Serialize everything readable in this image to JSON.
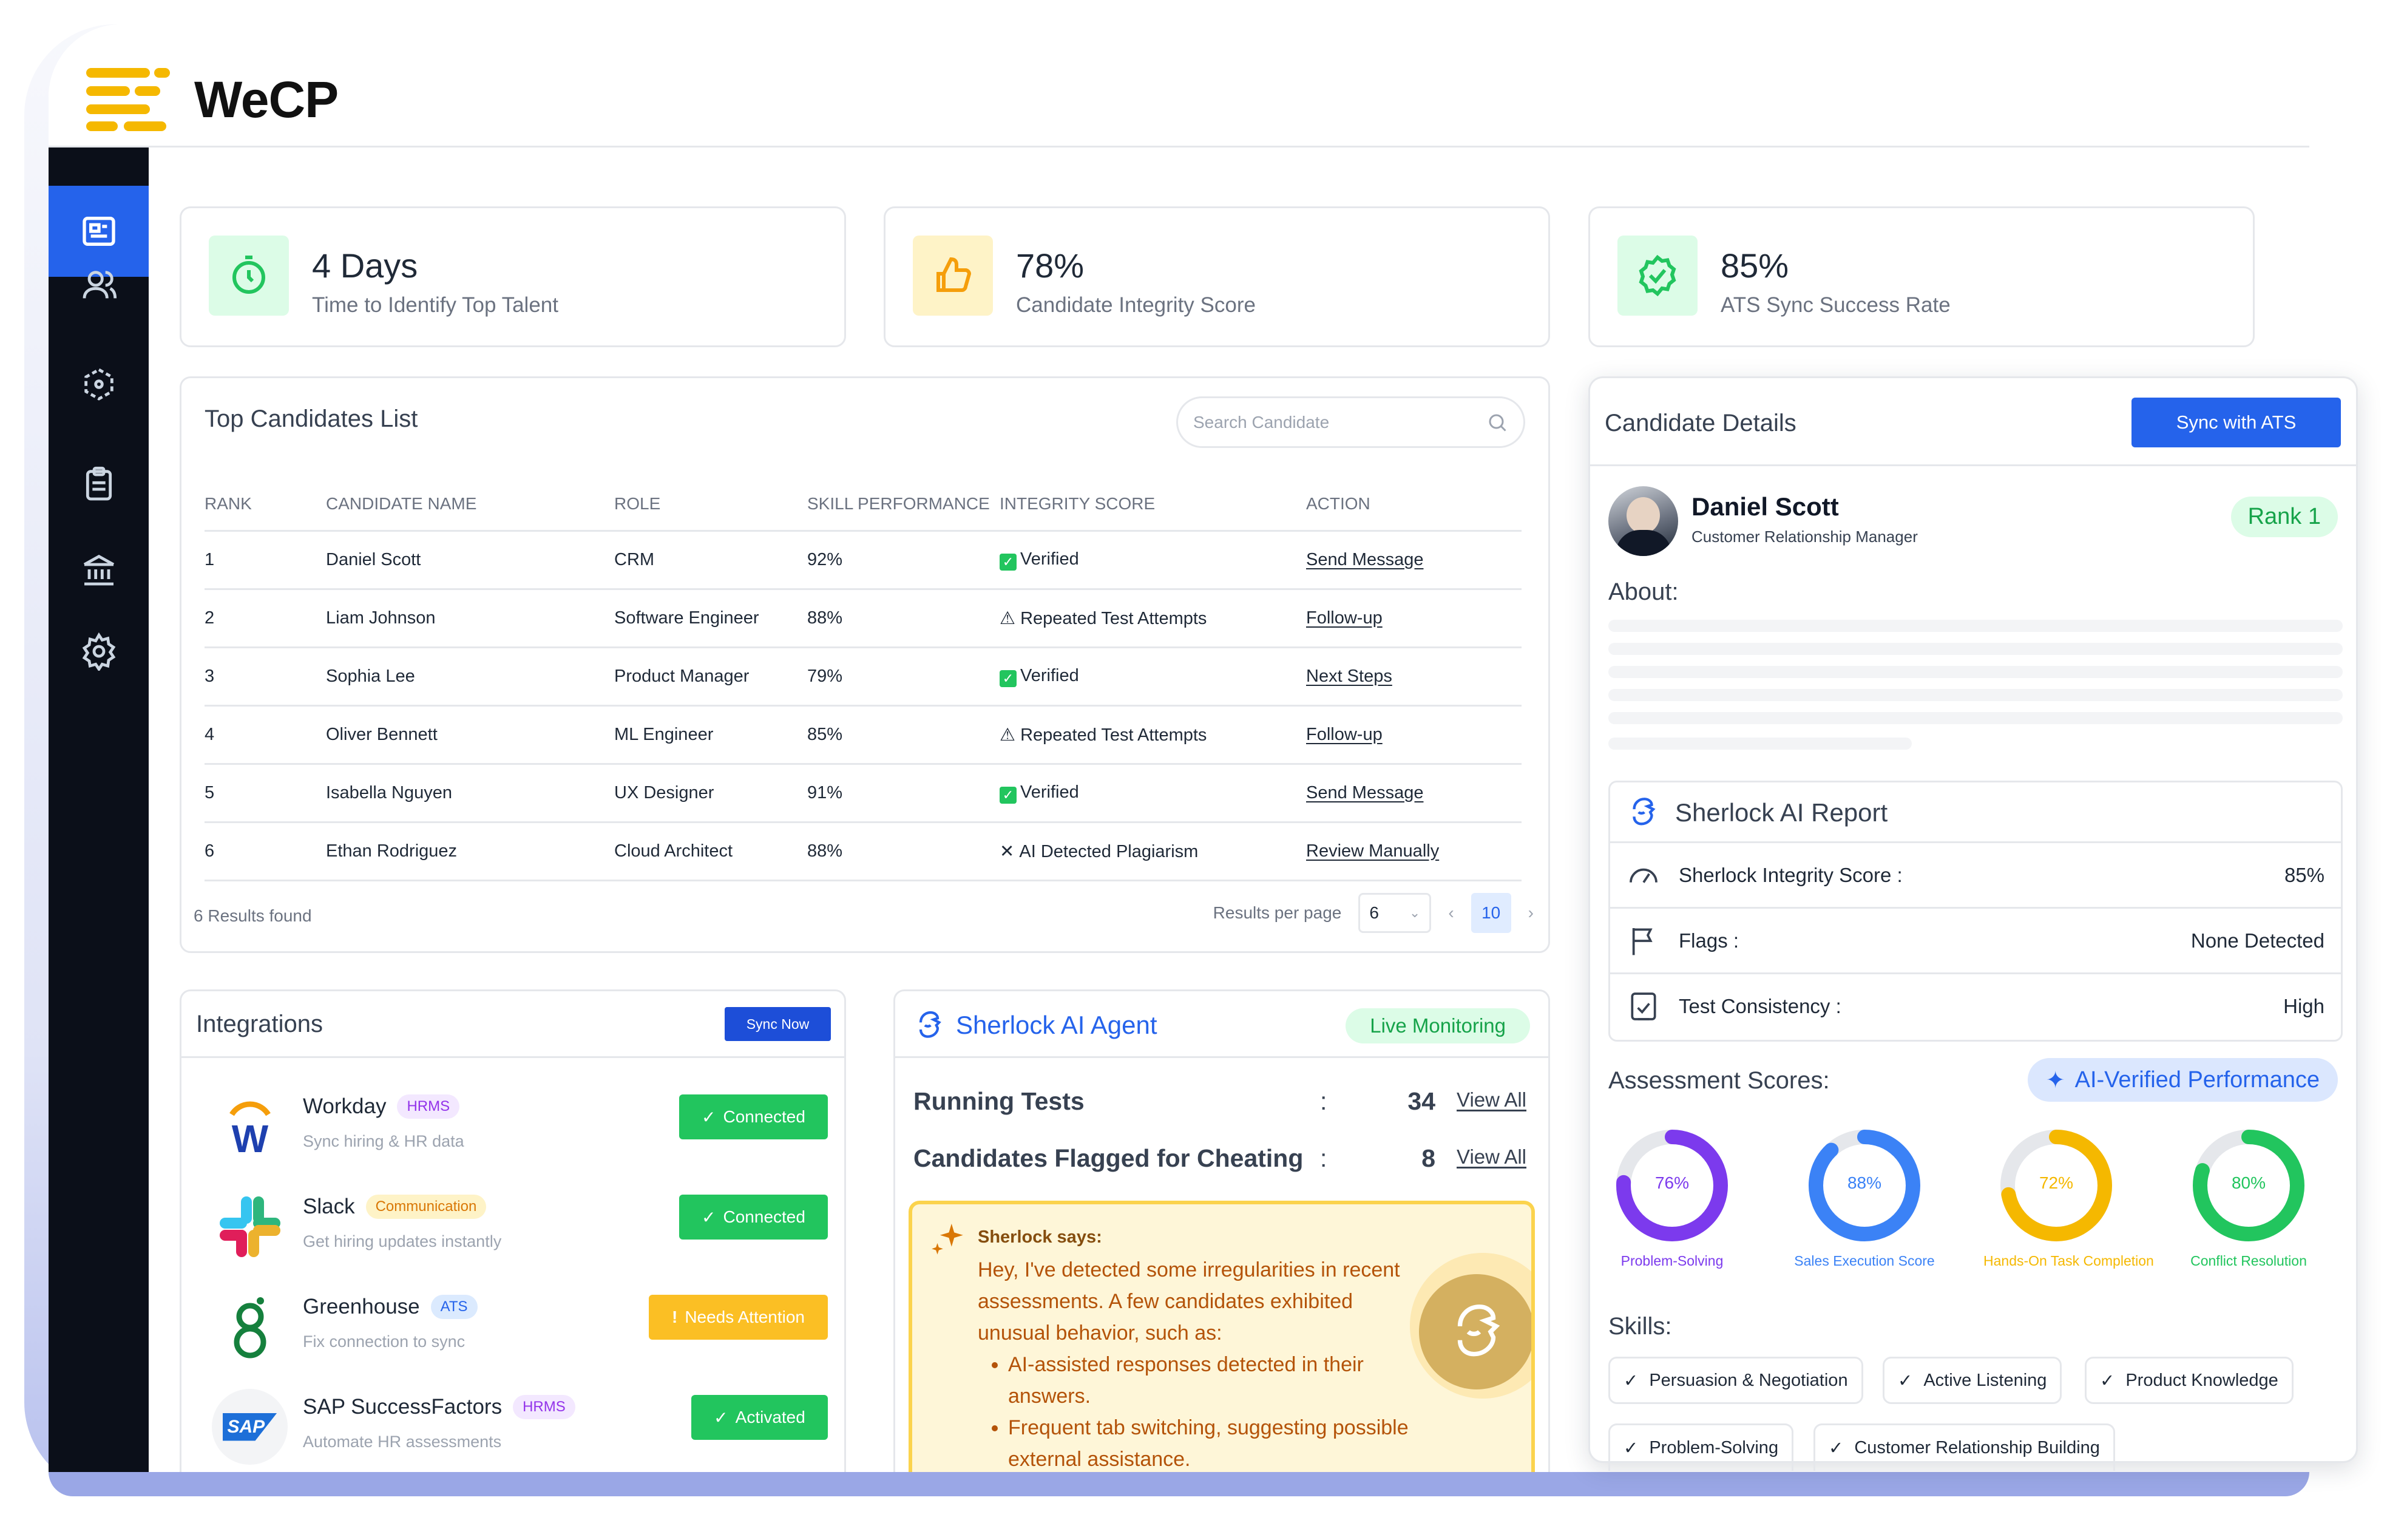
{
  "brand": {
    "name": "WeCP"
  },
  "sidebar": {
    "items": [
      {
        "icon": "report-icon",
        "active": true
      },
      {
        "icon": "users-icon"
      },
      {
        "icon": "cube-icon"
      },
      {
        "icon": "clipboard-icon"
      },
      {
        "icon": "bank-icon"
      },
      {
        "icon": "gear-icon"
      }
    ]
  },
  "stats": [
    {
      "value": "4 Days",
      "label": "Time to Identify Top Talent",
      "icon": "timer-icon",
      "color": "#22c55e"
    },
    {
      "value": "78%",
      "label": "Candidate Integrity Score",
      "icon": "thumbs-up-icon",
      "color": "#f59e0b"
    },
    {
      "value": "85%",
      "label": "ATS Sync Success Rate",
      "icon": "verified-badge-icon",
      "color": "#22c55e"
    }
  ],
  "candidates": {
    "title": "Top Candidates List",
    "search_placeholder": "Search Candidate",
    "columns": [
      "RANK",
      "CANDIDATE NAME",
      "ROLE",
      "SKILL PERFORMANCE",
      "INTEGRITY SCORE",
      "ACTION"
    ],
    "rows": [
      {
        "rank": "1",
        "name": "Daniel Scott",
        "role": "CRM",
        "skill": "92%",
        "integrity": "Verified",
        "status": "ok",
        "action": "Send Message"
      },
      {
        "rank": "2",
        "name": "Liam Johnson",
        "role": "Software Engineer",
        "skill": "88%",
        "integrity": "Repeated Test Attempts",
        "status": "warn",
        "action": "Follow-up"
      },
      {
        "rank": "3",
        "name": "Sophia Lee",
        "role": "Product Manager",
        "skill": "79%",
        "integrity": "Verified",
        "status": "ok",
        "action": "Next Steps"
      },
      {
        "rank": "4",
        "name": "Oliver Bennett",
        "role": "ML Engineer",
        "skill": "85%",
        "integrity": "Repeated Test Attempts",
        "status": "warn",
        "action": "Follow-up"
      },
      {
        "rank": "5",
        "name": "Isabella Nguyen",
        "role": "UX Designer",
        "skill": "91%",
        "integrity": "Verified",
        "status": "ok",
        "action": "Send Message"
      },
      {
        "rank": "6",
        "name": "Ethan Rodriguez",
        "role": "Cloud Architect",
        "skill": "88%",
        "integrity": "AI Detected Plagiarism",
        "status": "bad",
        "action": "Review Manually"
      }
    ],
    "results_found": "6 Results found",
    "per_page_label": "Results per page",
    "per_page_value": "6",
    "page": "10"
  },
  "integrations": {
    "title": "Integrations",
    "sync_label": "Sync Now",
    "items": [
      {
        "name": "Workday",
        "tag": "HRMS",
        "desc": "Sync hiring & HR data",
        "status": "Connected",
        "kind": "green"
      },
      {
        "name": "Slack",
        "tag": "Communication",
        "desc": "Get hiring updates instantly",
        "status": "Connected",
        "kind": "green"
      },
      {
        "name": "Greenhouse",
        "tag": "ATS",
        "desc": "Fix connection to sync",
        "status": "Needs Attention",
        "kind": "amber"
      },
      {
        "name": "SAP SuccessFactors",
        "tag": "HRMS",
        "desc": "Automate HR assessments",
        "status": "Activated",
        "kind": "green"
      }
    ]
  },
  "agent": {
    "title": "Sherlock AI Agent",
    "badge": "Live Monitoring",
    "rows": [
      {
        "label": "Running Tests",
        "count": "34",
        "link": "View All"
      },
      {
        "label": "Candidates Flagged for Cheating",
        "count": "8",
        "link": "View All"
      }
    ],
    "says_title": "Sherlock says:",
    "says_text": "Hey, I've detected some irregularities in recent assessments. A few candidates exhibited unusual behavior, such as:",
    "bullets": [
      "AI-assisted responses detected in their answers.",
      "Frequent tab switching, suggesting possible external assistance."
    ]
  },
  "details": {
    "title": "Candidate Details",
    "sync_label": "Sync with ATS",
    "name": "Daniel Scott",
    "role": "Customer Relationship Manager",
    "rank": "Rank 1",
    "about_label": "About:",
    "report_title": "Sherlock AI Report",
    "report_rows": [
      {
        "icon": "gauge-icon",
        "label": "Sherlock Integrity Score :",
        "value": "85%"
      },
      {
        "icon": "flag-icon",
        "label": "Flags :",
        "value": "None Detected"
      },
      {
        "icon": "checklist-icon",
        "label": "Test Consistency :",
        "value": "High"
      }
    ],
    "assessment_label": "Assessment Scores:",
    "ai_badge": "AI-Verified Performance",
    "scores": [
      {
        "value": 76,
        "label": "76%",
        "name": "Problem-Solving",
        "color": "#7c3aed"
      },
      {
        "value": 88,
        "label": "88%",
        "name": "Sales Execution Score",
        "color": "#3b82f6"
      },
      {
        "value": 72,
        "label": "72%",
        "name": "Hands-On Task Completion",
        "color": "#f5b800"
      },
      {
        "value": 80,
        "label": "80%",
        "name": "Conflict Resolution",
        "color": "#22c55e"
      }
    ],
    "skills_label": "Skills:",
    "skills": [
      "Persuasion & Negotiation",
      "Active Listening",
      "Product Knowledge",
      "Problem-Solving",
      "Customer Relationship Building"
    ]
  }
}
